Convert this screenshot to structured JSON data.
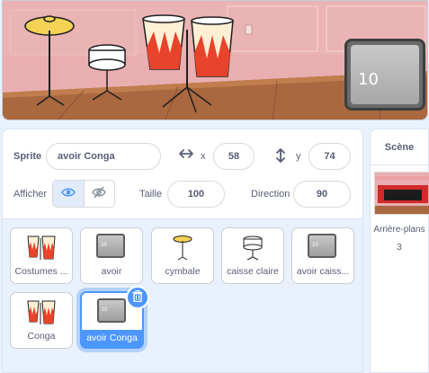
{
  "stage": {
    "readout": "10"
  },
  "sprite_info": {
    "sprite_label": "Sprite",
    "sprite_name": "avoir Conga",
    "x_label": "x",
    "x_value": "58",
    "y_label": "y",
    "y_value": "74",
    "show_label": "Afficher",
    "size_label": "Taille",
    "size_value": "100",
    "direction_label": "Direction",
    "direction_value": "90"
  },
  "sprites": [
    {
      "name": "Costumes ...",
      "thumb": "conga"
    },
    {
      "name": "avoir",
      "thumb": "gray-10"
    },
    {
      "name": "cymbale",
      "thumb": "cymbal"
    },
    {
      "name": "caisse claire",
      "thumb": "snare"
    },
    {
      "name": "avoir caiss...",
      "thumb": "gray-10b"
    },
    {
      "name": "Conga",
      "thumb": "conga"
    },
    {
      "name": "avoir Conga",
      "thumb": "gray-10",
      "selected": true
    }
  ],
  "stage_pane": {
    "title": "Scène",
    "backdrops_label": "Arrière-plans",
    "backdrops_count": "3"
  },
  "colors": {
    "accent": "#4c97ff",
    "text": "#575e75"
  }
}
